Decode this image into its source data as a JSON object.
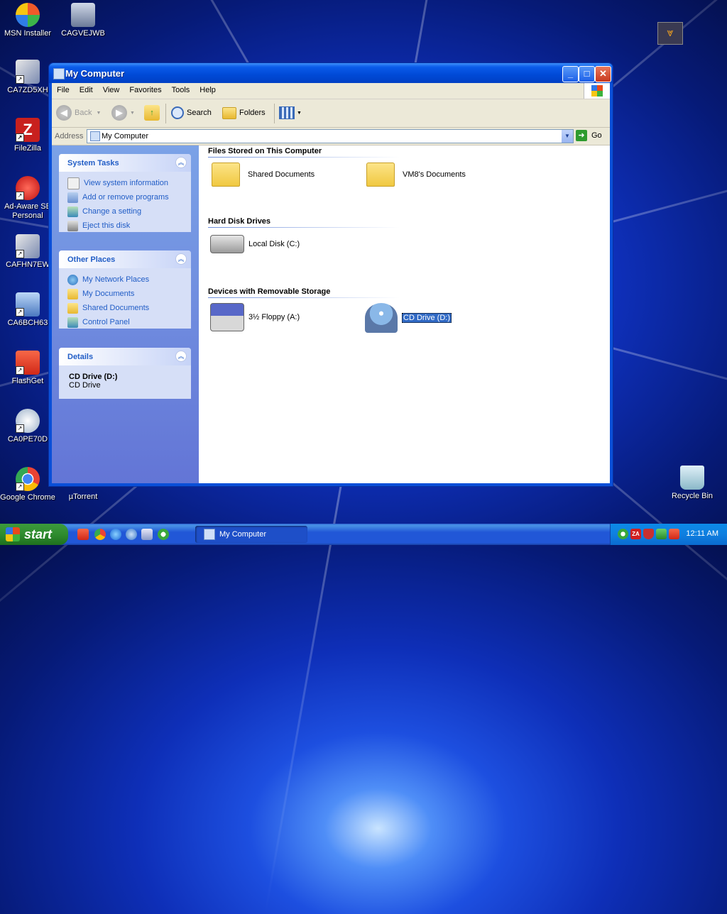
{
  "desktop": {
    "icons": [
      {
        "label": "MSN Installer",
        "icon": "msn-butterfly-icon"
      },
      {
        "label": "CAGVEJWB",
        "icon": "installer-icon"
      },
      {
        "label": "CA7ZD5XH",
        "icon": "setup-icon"
      },
      {
        "label": "FileZilla",
        "icon": "filezilla-icon"
      },
      {
        "label": "Ad-Aware SE Personal",
        "icon": "adaware-icon"
      },
      {
        "label": "CAFHN7EW",
        "icon": "setup-icon"
      },
      {
        "label": "CA6BCH63",
        "icon": "computer-cd-icon"
      },
      {
        "label": "FlashGet",
        "icon": "flashget-icon"
      },
      {
        "label": "CA0PE70D",
        "icon": "cd-setup-icon"
      },
      {
        "label": "Google Chrome",
        "icon": "chrome-icon"
      },
      {
        "label": "µTorrent",
        "icon": "utorrent-icon"
      },
      {
        "label": "Recycle Bin",
        "icon": "recycle-bin-icon"
      }
    ]
  },
  "window": {
    "title": "My Computer",
    "menu": [
      "File",
      "Edit",
      "View",
      "Favorites",
      "Tools",
      "Help"
    ],
    "toolbar": {
      "back": "Back",
      "search": "Search",
      "folders": "Folders"
    },
    "address": {
      "label": "Address",
      "value": "My Computer",
      "go": "Go"
    },
    "tasks": {
      "system": {
        "title": "System Tasks",
        "items": [
          "View system information",
          "Add or remove programs",
          "Change a setting",
          "Eject this disk"
        ]
      },
      "other": {
        "title": "Other Places",
        "items": [
          "My Network Places",
          "My Documents",
          "Shared Documents",
          "Control Panel"
        ]
      },
      "details": {
        "title": "Details",
        "name": "CD Drive (D:)",
        "type": "CD Drive"
      }
    },
    "groups": {
      "files": {
        "title": "Files Stored on This Computer",
        "items": [
          "Shared Documents",
          "VM8's Documents"
        ]
      },
      "hdd": {
        "title": "Hard Disk Drives",
        "items": [
          "Local Disk (C:)"
        ]
      },
      "removable": {
        "title": "Devices with Removable Storage",
        "items": [
          "3½ Floppy (A:)",
          "CD Drive (D:)"
        ]
      }
    }
  },
  "taskbar": {
    "start": "start",
    "task": "My Computer",
    "clock": "12:11 AM"
  },
  "colors": {
    "accent": "#0a4fd8",
    "taskbar": "#2157d7",
    "start": "#2f8c2f"
  }
}
